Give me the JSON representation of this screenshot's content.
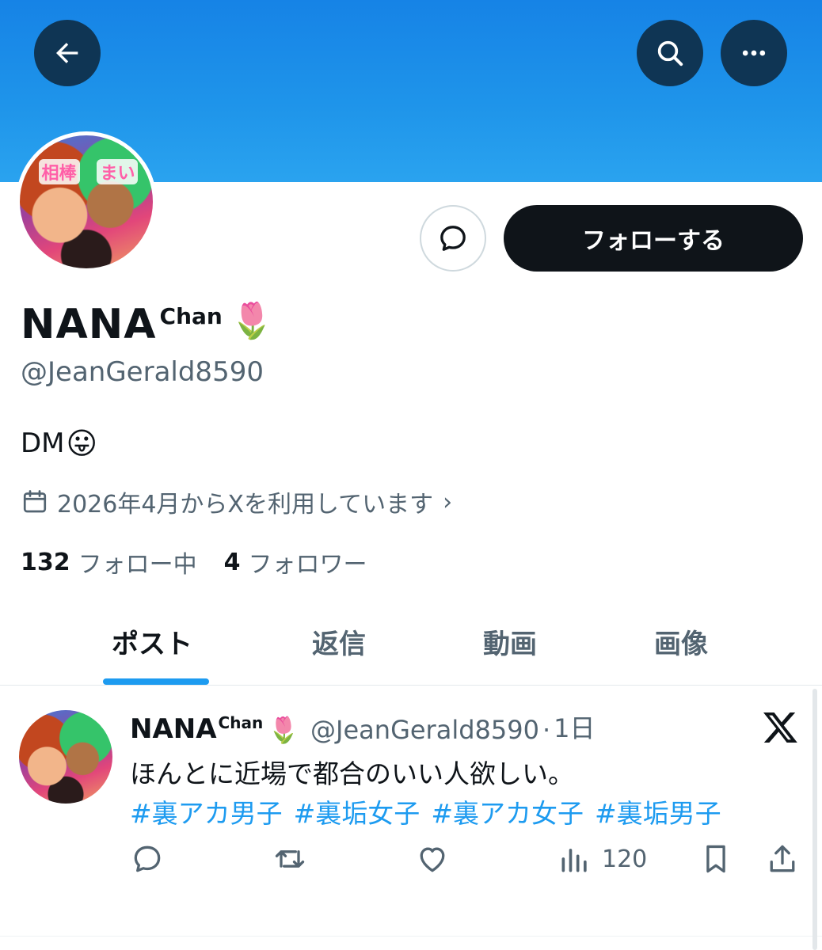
{
  "header": {
    "back_icon": "arrow-left-icon",
    "search_icon": "search-icon",
    "more_icon": "more-horizontal-icon",
    "banner_color": "#1f95ea"
  },
  "avatar": {
    "art_tags": [
      "相棒",
      "まい"
    ]
  },
  "actions": {
    "dm_icon": "message-bubble-icon",
    "follow_label": "フォローする"
  },
  "profile": {
    "name_main": "NANA",
    "name_sup": "Chan",
    "name_emoji": "🌷",
    "handle": "@JeanGerald8590",
    "bio_text": "DM",
    "bio_emoji": "😛",
    "joined_text": "2026年4月からXを利用しています",
    "joined_chevron": "›",
    "following_count": "132",
    "following_label": "フォロー中",
    "followers_count": "4",
    "followers_label": "フォロワー"
  },
  "tabs": [
    {
      "label": "ポスト",
      "active": true
    },
    {
      "label": "返信",
      "active": false
    },
    {
      "label": "動画",
      "active": false
    },
    {
      "label": "画像",
      "active": false
    }
  ],
  "post": {
    "name_main": "NANA",
    "name_sup": "Chan",
    "name_emoji": "🌷",
    "handle": "@JeanGerald8590",
    "separator": "·",
    "time": "1日",
    "text": "ほんとに近場で都合のいい人欲しい。",
    "hashtags": [
      "#裏アカ男子",
      "#裏垢女子",
      "#裏アカ女子",
      "#裏垢男子"
    ],
    "views": "120"
  },
  "colors": {
    "accent": "#1d9bf0",
    "primary_text": "#0f1419",
    "secondary_text": "#536471"
  }
}
